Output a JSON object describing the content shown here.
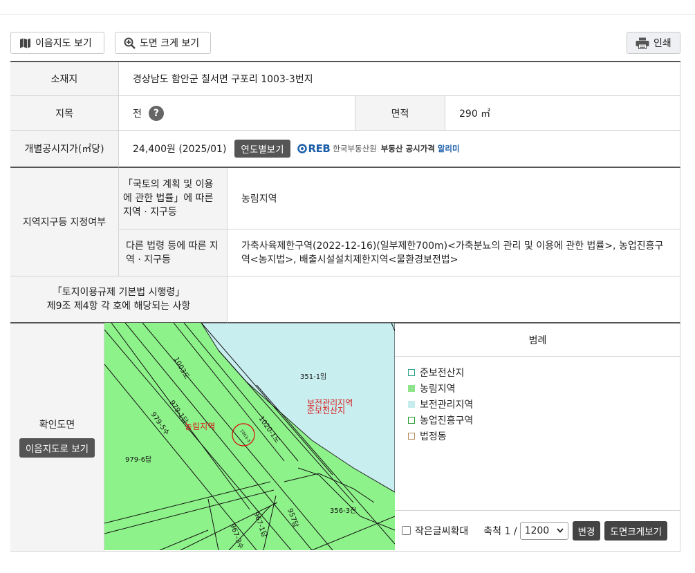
{
  "toolbar": {
    "map_btn": "이음지도 보기",
    "zoom_btn": "도면 크게 보기",
    "print_btn": "인쇄"
  },
  "info": {
    "location_label": "소재지",
    "location_value": "경상남도 함안군 칠서면 구포리 1003-3번지",
    "landcat_label": "지목",
    "landcat_value": "전",
    "help_mark": "?",
    "area_label": "면적",
    "area_value": "290 ㎡",
    "price_label": "개별공시지가(㎡당)",
    "price_value": "24,400원 (2025/01)",
    "yearly_btn": "연도별보기",
    "reb_mark": "REB",
    "reb_org": "한국부동산원",
    "reb_service_pre": "부동산 공시가격",
    "reb_service_post": "알리미",
    "zone_label": "지역지구등 지정여부",
    "zone_law1_label": "「국토의 계획 및 이용에 관한 법률」에 따른 지역 · 지구등",
    "zone_law1_value": "농림지역",
    "zone_law2_label": "다른 법령 등에 따른 지역 · 지구등",
    "zone_law2_value": "가축사육제한구역(2022-12-16)(일부제한700m)<가축분뇨의 관리 및 이용에 관한 법률>, 농업진흥구역<농지법>, 배출시설설치제한지역<물환경보전법>",
    "regulation_label_1": "「토지이용규제 기본법 시행령」",
    "regulation_label_2": "제9조 제4항 각 호에 해당되는 사항",
    "regulation_value": ""
  },
  "map": {
    "label": "확인도면",
    "open_btn": "이음지도로 보기",
    "parcels": [
      "351-1임",
      "979-1답",
      "979-5수",
      "979-6답",
      "1003도",
      "1020-1도",
      "356-3전",
      "967-1답",
      "957답",
      "967-3수",
      "1003-3"
    ],
    "zone_labels": [
      "농림지역",
      "보전관리지역",
      "준보전산지"
    ]
  },
  "legend": {
    "title": "범례",
    "items": [
      {
        "label": "준보전산지",
        "border": "#2aa58c",
        "fill": "#ffffff"
      },
      {
        "label": "농림지역",
        "border": "#8fe38a",
        "fill": "#8fe38a"
      },
      {
        "label": "보전관리지역",
        "border": "#c7ecee",
        "fill": "#c7ecee"
      },
      {
        "label": "농업진흥구역",
        "border": "#1f9a2a",
        "fill": "#ffffff"
      },
      {
        "label": "법정동",
        "border": "#b38a5a",
        "fill": "#ffffff"
      }
    ]
  },
  "controls": {
    "small_text_label": "작은글씨확대",
    "scale_label": "축척 1 /",
    "scale_value": "1200",
    "change_btn": "변경",
    "enlarge_btn": "도면크게보기"
  }
}
